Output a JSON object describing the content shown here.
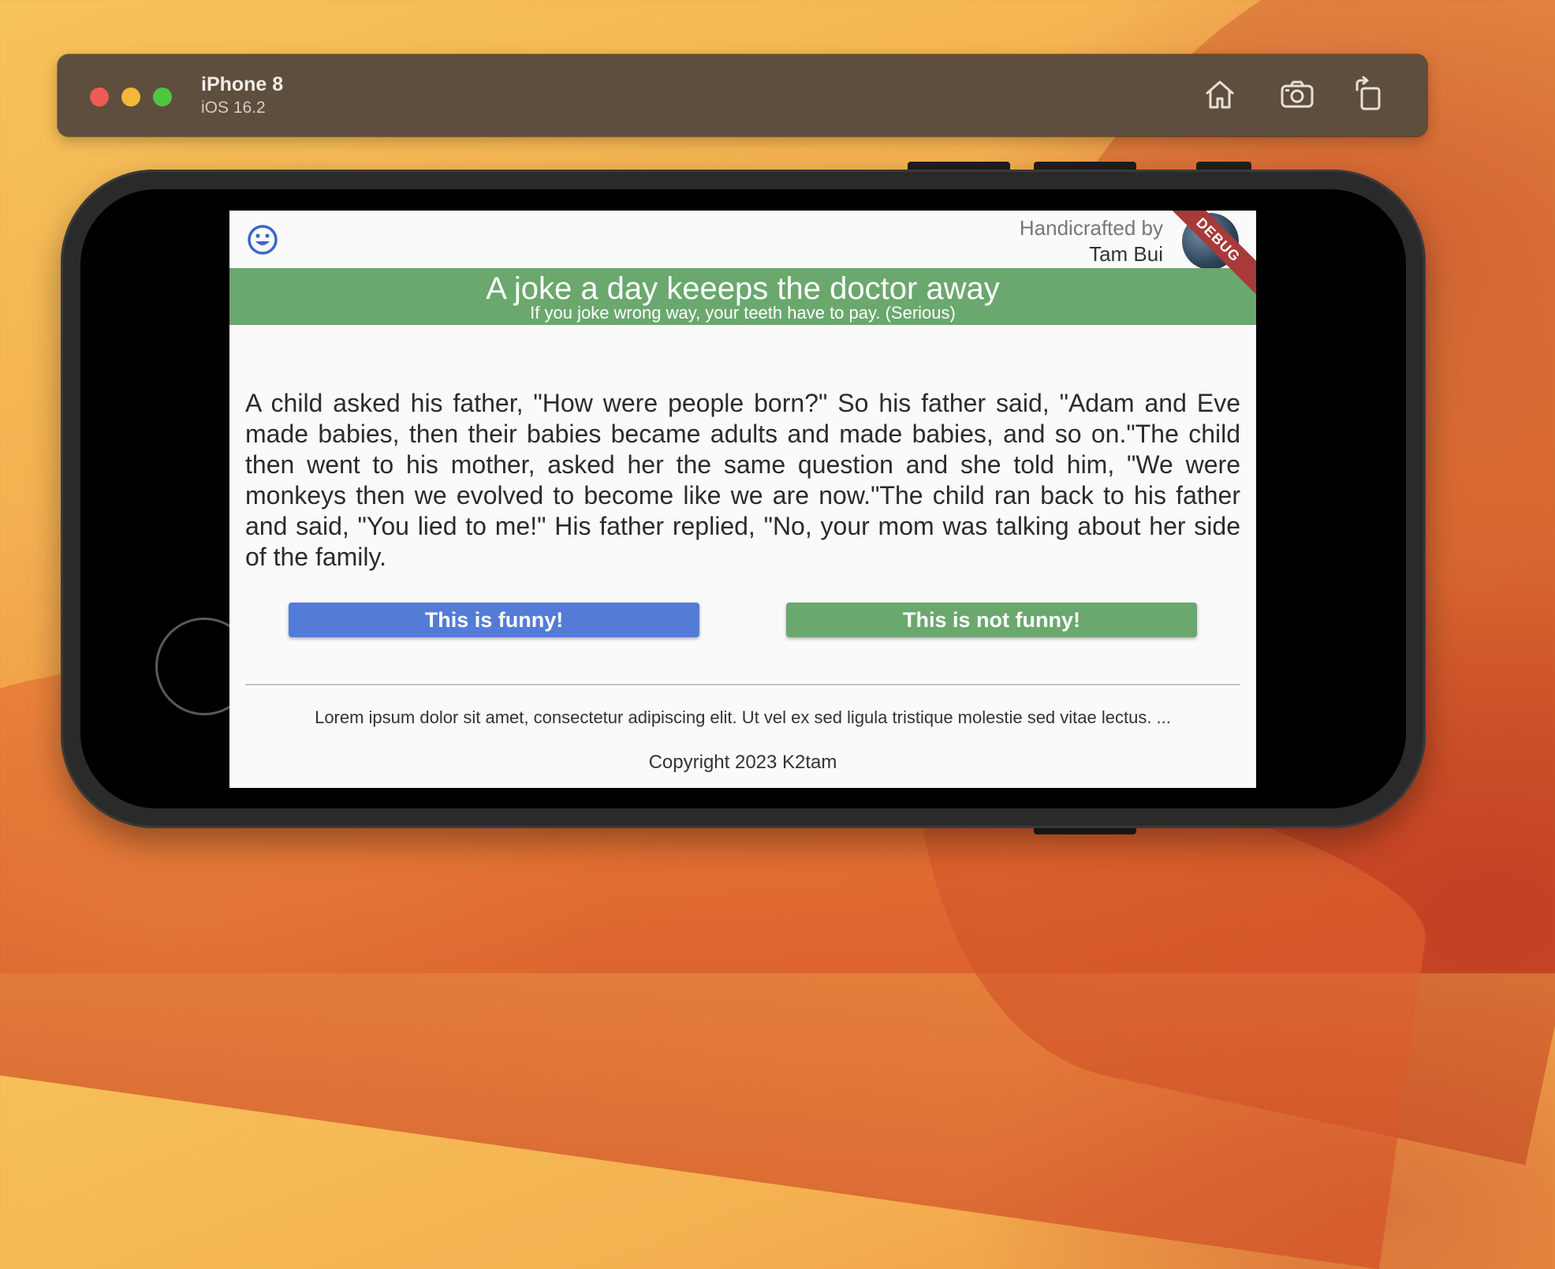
{
  "simulator": {
    "device_name": "iPhone 8",
    "os_version": "iOS 16.2",
    "icons": [
      "home-icon",
      "screenshot-icon",
      "rotate-icon"
    ]
  },
  "app": {
    "header": {
      "logo_icon": "smiley-face-icon",
      "credit_line1": "Handicrafted by",
      "credit_line2": "Tam Bui",
      "debug_label": "DEBUG"
    },
    "banner": {
      "title": "A joke a day keeeps the doctor away",
      "subtitle": "If you joke wrong way, your teeth have to pay. (Serious)",
      "color": "#6aa86e"
    },
    "joke_text": "A child asked his father, \"How were people born?\" So his father said, \"Adam and Eve made babies, then their babies became adults and made babies, and so on.\"The child then went to his mother, asked her the same question and she told him, \"We were monkeys then we evolved to become like we are now.\"The child ran back to his father and said, \"You lied to me!\" His father replied, \"No, your mom was talking about her side of the family.",
    "buttons": {
      "funny_label": "This is funny!",
      "not_funny_label": "This is not funny!",
      "funny_color": "#547bd6",
      "not_funny_color": "#6aa86e"
    },
    "footer": {
      "lorem": "Lorem ipsum dolor sit amet, consectetur adipiscing elit. Ut vel ex sed ligula tristique molestie sed vitae lectus. ...",
      "copyright": "Copyright 2023 K2tam"
    }
  }
}
